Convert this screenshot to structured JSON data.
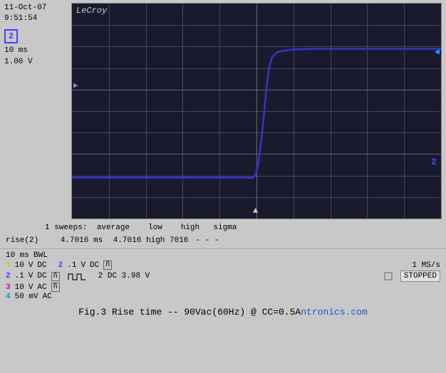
{
  "datetime": {
    "date": "11-Oct-07",
    "time": "9:51:54"
  },
  "channel1": {
    "label": "2",
    "timeDiv": "10 ms",
    "voltDiv": "1.00 V"
  },
  "lecroy": "LeCroy",
  "stats": {
    "sweeps": "1 sweeps:",
    "average_label": "average",
    "low_label": "low",
    "high_label": "high",
    "sigma_label": "sigma",
    "param": "rise(2)",
    "average_val": "4.7016 ms",
    "low_val": "4.7016",
    "high_val": "7016",
    "sigma_val": "- - -"
  },
  "bottom": {
    "timeDiv": "10 ms",
    "bwl": "BWL",
    "ch1": {
      "num": "1",
      "volts": "10",
      "unit": "V",
      "coupling": "DC"
    },
    "ch2": {
      "num": "2",
      "volts": ".1",
      "unit": "V",
      "coupling": "DC"
    },
    "ch3": {
      "num": "3",
      "volts": "10",
      "unit": "V",
      "coupling": "AC"
    },
    "ch4": {
      "num": "4",
      "volts": "50 mV",
      "coupling": "AC"
    },
    "ch2_dc_val": "2 DC 3.98 V",
    "sampleRate": "1 MS/s",
    "status": "STOPPED"
  },
  "caption": {
    "text": "Fig.3  Rise time  --  90Vac(60Hz) @  CC=0.5A",
    "brand": "ntronics.com"
  }
}
